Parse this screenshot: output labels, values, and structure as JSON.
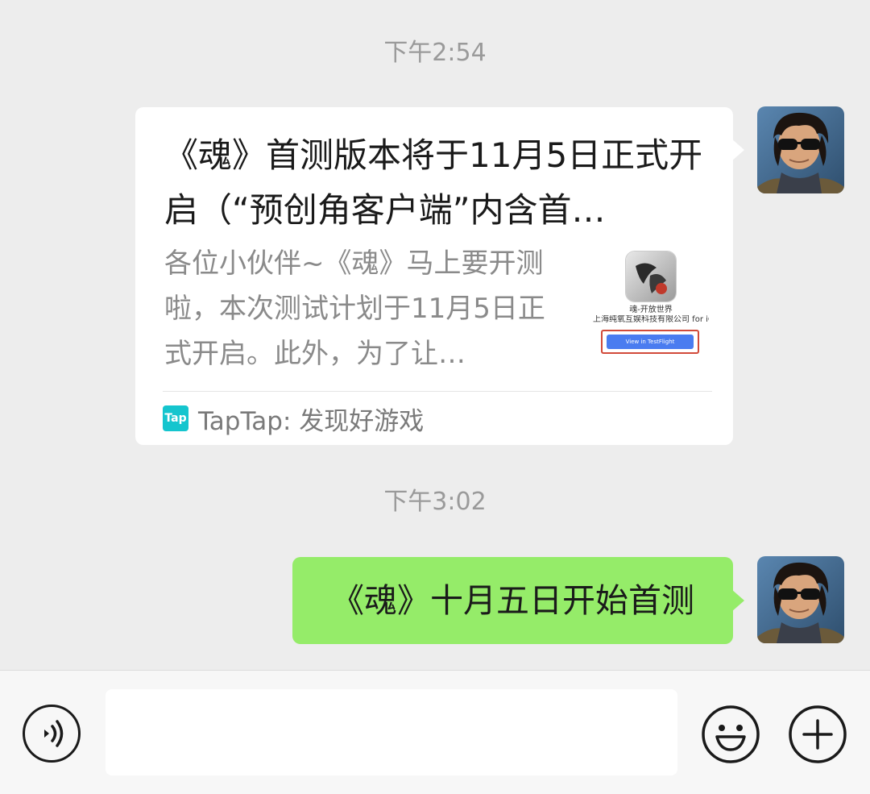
{
  "timestamps": {
    "first": "下午2:54",
    "second": "下午3:02"
  },
  "link_card": {
    "title": "《魂》首测版本将于11月5日正式开启（“预创角客户端”内含首…",
    "description": "各位小伙伴~《魂》马上要开测啦，本次测试计划于11月5日正式开启。此外，为了让…",
    "thumbnail": {
      "app_name": "魂-开放世界",
      "company": "上海纯氧互娱科技有限公司 for iOS",
      "button_label": "View in TestFlight"
    },
    "source_logo": "Tap",
    "source_name": "TapTap: 发现好游戏"
  },
  "message": {
    "text": "《魂》十月五日开始首测"
  },
  "input_bar": {
    "voice_icon": "voice-icon",
    "emoji_icon": "emoji-icon",
    "plus_icon": "plus-icon"
  },
  "colors": {
    "background": "#ededed",
    "bubble_green": "#95ec69",
    "card_white": "#ffffff",
    "taptap_teal": "#15c5ce"
  }
}
